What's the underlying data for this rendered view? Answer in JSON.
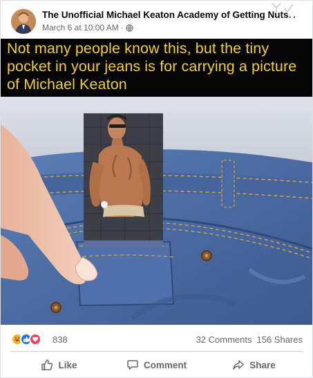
{
  "post": {
    "page_name": "The Unofficial Michael Keaton Academy of Getting Nuts",
    "timestamp": "March 6 at 10:00 AM",
    "separator": " · ",
    "more_label": "···"
  },
  "media": {
    "caption": "Not many people know this, but the tiny pocket in your jeans is for carrying a picture of Michael Keaton",
    "caption_color": "#f2cf3b",
    "denim_color": "#4f6fa6"
  },
  "stats": {
    "reaction_count": "838",
    "reaction_icons": [
      "haha-icon",
      "like-icon",
      "love-icon"
    ],
    "comments": "32 Comments",
    "shares": "156 Shares"
  },
  "actions": {
    "like": "Like",
    "comment": "Comment",
    "share": "Share"
  },
  "colors": {
    "like_blue": "#1877f2",
    "love_red": "#f33e58",
    "haha_yellow": "#f7b125",
    "secondary_text": "#65676b"
  }
}
